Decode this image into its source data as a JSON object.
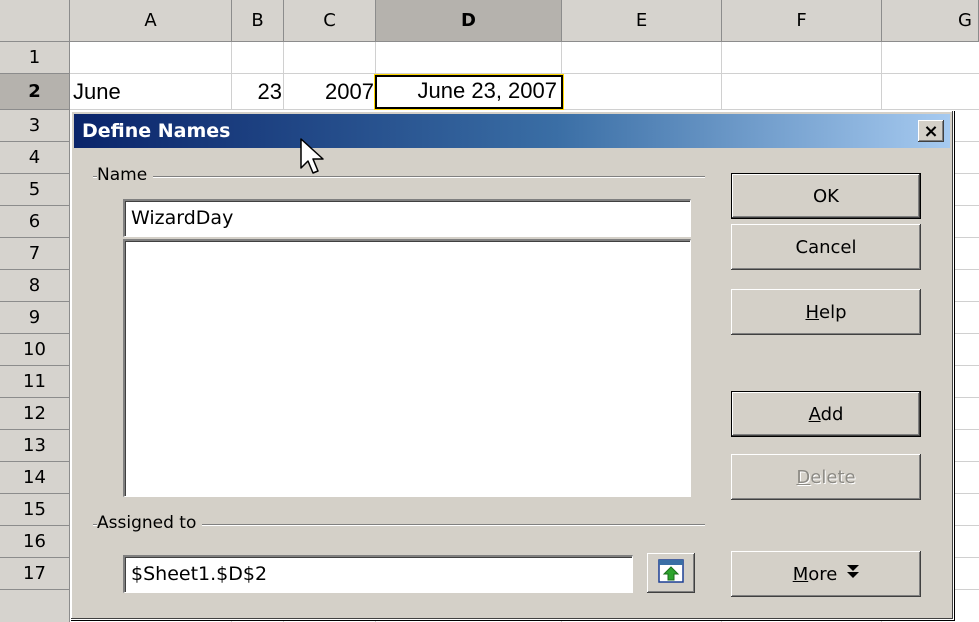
{
  "sheet": {
    "columns": [
      "A",
      "B",
      "C",
      "D",
      "E",
      "F",
      "G"
    ],
    "selected_column": "D",
    "rows": [
      "1",
      "2",
      "3",
      "4",
      "5",
      "6",
      "7",
      "8",
      "9",
      "10",
      "11",
      "12",
      "13",
      "14",
      "15",
      "16",
      "17"
    ],
    "selected_row": "2",
    "cells": {
      "A2": "June",
      "B2": "23",
      "C2": "2007",
      "D2": "June 23, 2007"
    }
  },
  "dialog": {
    "title": "Define Names",
    "close_label": "×",
    "name_group_label": "Name",
    "name_value": "WizardDay",
    "assigned_group_label": "Assigned to",
    "assigned_value": "$Sheet1.$D$2",
    "buttons": {
      "ok": "OK",
      "cancel": "Cancel",
      "help_mnemonic": "H",
      "help_rest": "elp",
      "add_mnemonic": "A",
      "add_rest": "dd",
      "delete_mnemonic": "D",
      "delete_rest": "elete",
      "more_mnemonic": "M",
      "more_rest": "ore",
      "more_arrow": "⯯"
    }
  },
  "icons": {
    "shrink_button": "shrink-dialog-icon",
    "cursor": "mouse-pointer-icon"
  }
}
